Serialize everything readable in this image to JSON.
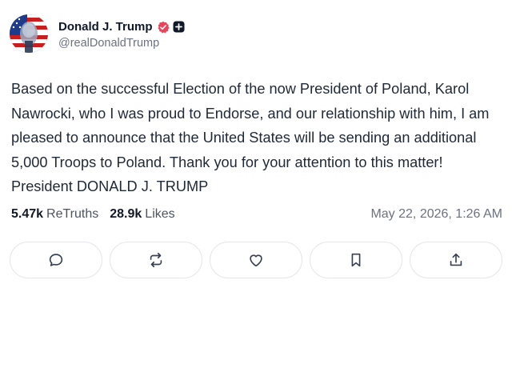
{
  "post": {
    "author": {
      "display_name": "Donald J. Trump",
      "handle": "@realDonaldTrump",
      "verified_icon": "verified-badge-icon",
      "badge_icon": "plus-badge-icon"
    },
    "text": "Based on the successful Election of the now President of Poland, Karol Nawrocki, who I was proud to Endorse, and our relationship with him, I am pleased to announce that the United States will be sending an additional 5,000 Troops to Poland. Thank you for your attention to this matter! President DONALD J. TRUMP",
    "stats": {
      "retruths_count": "5.47k",
      "retruths_label": "ReTruths",
      "likes_count": "28.9k",
      "likes_label": "Likes"
    },
    "timestamp": "May 22, 2026, 1:26 AM",
    "actions": [
      "reply-icon",
      "retruth-icon",
      "like-icon",
      "bookmark-icon",
      "share-icon"
    ]
  },
  "colors": {
    "verified": "#e8455b",
    "icon": "#374151",
    "border": "#e5e7eb"
  }
}
